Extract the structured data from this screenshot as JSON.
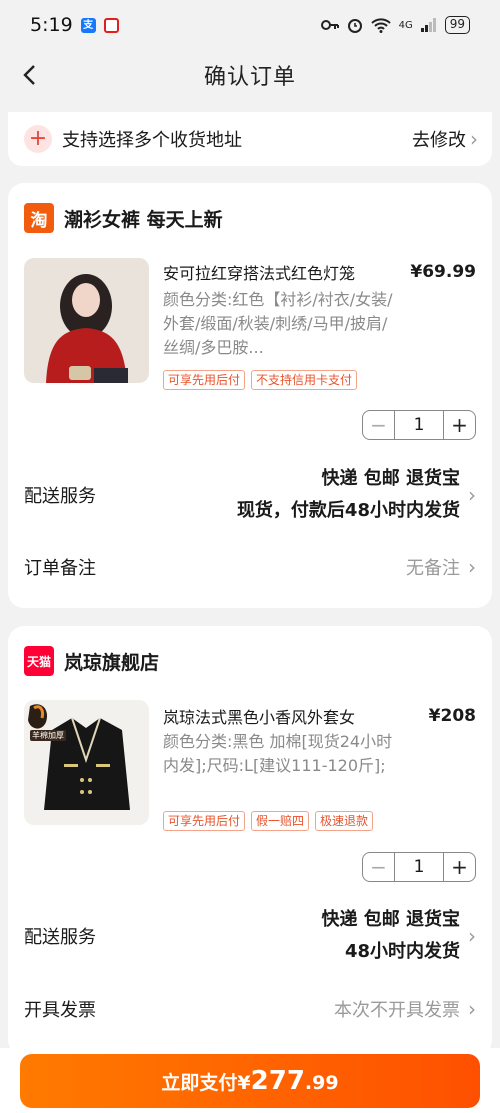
{
  "status_bar": {
    "time": "5:19",
    "app1": "支",
    "network": "4G",
    "signal_label": "6",
    "battery": "99"
  },
  "nav": {
    "title": "确认订单",
    "back_icon": "chevron-left-icon"
  },
  "address": {
    "label": "支持选择多个收货地址",
    "action": "去修改"
  },
  "stores": [
    {
      "logo_text": "淘",
      "name": "潮衫女裤 每天上新",
      "product": {
        "title": "安可拉红穿搭法式红色灯笼",
        "price": "¥69.99",
        "spec": "颜色分类:红色【衬衫/衬衣/女装/外套/缎面/秋装/刺绣/马甲/披肩/丝绸/多巴胺...",
        "tags": [
          "可享先用后付",
          "不支持信用卡支付"
        ],
        "quantity": "1"
      },
      "delivery": {
        "label": "配送服务",
        "line1": "快递 包邮 退货宝",
        "line2": "现货，付款后48小时内发货"
      },
      "note": {
        "label": "订单备注",
        "value": "无备注"
      }
    },
    {
      "logo_text": "天猫",
      "name": "岚琼旗舰店",
      "product": {
        "title": "岚琼法式黑色小香风外套女",
        "price": "¥208",
        "spec": "颜色分类:黑色 加棉[现货24小时内发];尺码:L[建议111-120斤];",
        "thumb_badge": "羊棉加厚",
        "tags": [
          "可享先用后付",
          "假一赔四",
          "极速退款"
        ],
        "quantity": "1"
      },
      "delivery": {
        "label": "配送服务",
        "line1": "快递 包邮 退货宝",
        "line2": "48小时内发货"
      },
      "invoice": {
        "label": "开具发票",
        "value": "本次不开具发票"
      }
    }
  ],
  "pay": {
    "label": "立即支付",
    "currency": "¥",
    "amount_int": "277",
    "amount_dec": ".99"
  },
  "colors": {
    "accent": "#ff5000",
    "brand_tao": "#f25c0f",
    "brand_tmall": "#ff0036"
  }
}
